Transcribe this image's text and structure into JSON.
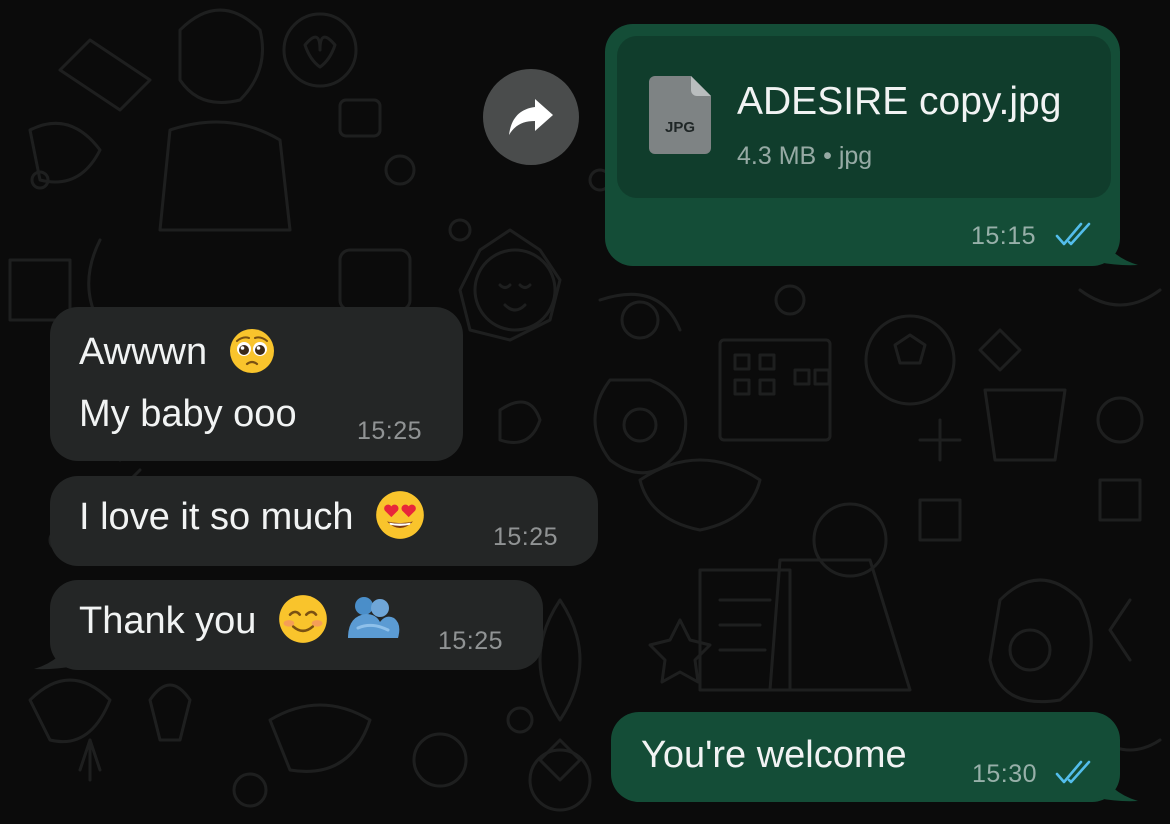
{
  "messages": [
    {
      "direction": "outgoing",
      "type": "file",
      "file_name": "ADESIRE copy.jpg",
      "file_type_label": "JPG",
      "file_meta": "4.3 MB • jpg",
      "time": "15:15",
      "status": "read"
    },
    {
      "direction": "incoming",
      "line1": "Awwwn",
      "line1_emoji": "pleading-face-emoji",
      "line2": "My baby ooo",
      "time": "15:25"
    },
    {
      "direction": "incoming",
      "text": "I love it so much",
      "emoji": "heart-eyes-emoji",
      "time": "15:25"
    },
    {
      "direction": "incoming",
      "text": "Thank you",
      "emoji": [
        "smiling-face-emoji",
        "people-hugging-emoji"
      ],
      "time": "15:25"
    },
    {
      "direction": "outgoing",
      "text": "You're welcome",
      "time": "15:30",
      "status": "read"
    }
  ],
  "icons": {
    "forward": "forward-arrow-icon",
    "file": "jpg-file-icon",
    "read_receipt": "double-check-icon"
  },
  "colors": {
    "background": "#0b0b0b",
    "outgoing_bubble": "#144d37",
    "incoming_bubble": "#242626",
    "read_tick": "#53bdeb"
  }
}
